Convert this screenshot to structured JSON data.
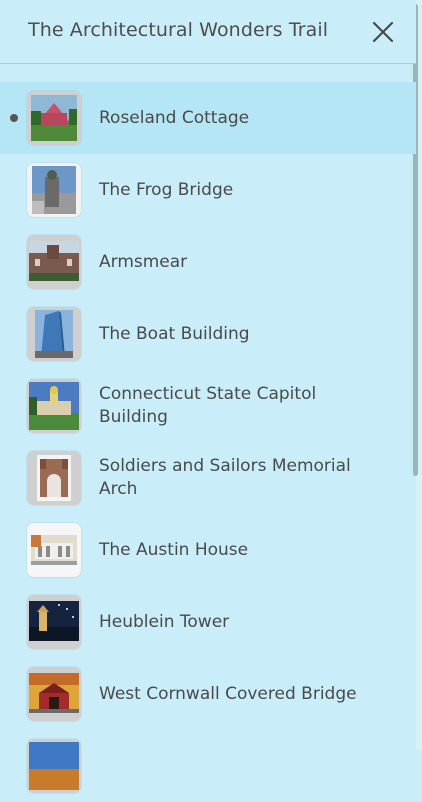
{
  "header": {
    "title": "The Architectural Wonders Trail",
    "close_icon": "close-icon"
  },
  "items": [
    {
      "label": "Roseland Cottage",
      "active": true,
      "thumb": "roseland-cottage-thumbnail"
    },
    {
      "label": "The Frog Bridge",
      "active": false,
      "thumb": "frog-bridge-thumbnail"
    },
    {
      "label": "Armsmear",
      "active": false,
      "thumb": "armsmear-thumbnail"
    },
    {
      "label": "The Boat Building",
      "active": false,
      "thumb": "boat-building-thumbnail"
    },
    {
      "label": "Connecticut State Capitol Building",
      "active": false,
      "thumb": "state-capitol-thumbnail"
    },
    {
      "label": "Soldiers and Sailors Memorial Arch",
      "active": false,
      "thumb": "memorial-arch-thumbnail"
    },
    {
      "label": "The Austin House",
      "active": false,
      "thumb": "austin-house-thumbnail"
    },
    {
      "label": "Heublein Tower",
      "active": false,
      "thumb": "heublein-tower-thumbnail"
    },
    {
      "label": "West Cornwall Covered Bridge",
      "active": false,
      "thumb": "covered-bridge-thumbnail"
    }
  ],
  "colors": {
    "background": "#c9eef9",
    "active_row": "#b5e6f5",
    "text": "#4a4a4a",
    "divider": "#a9cdd8"
  }
}
